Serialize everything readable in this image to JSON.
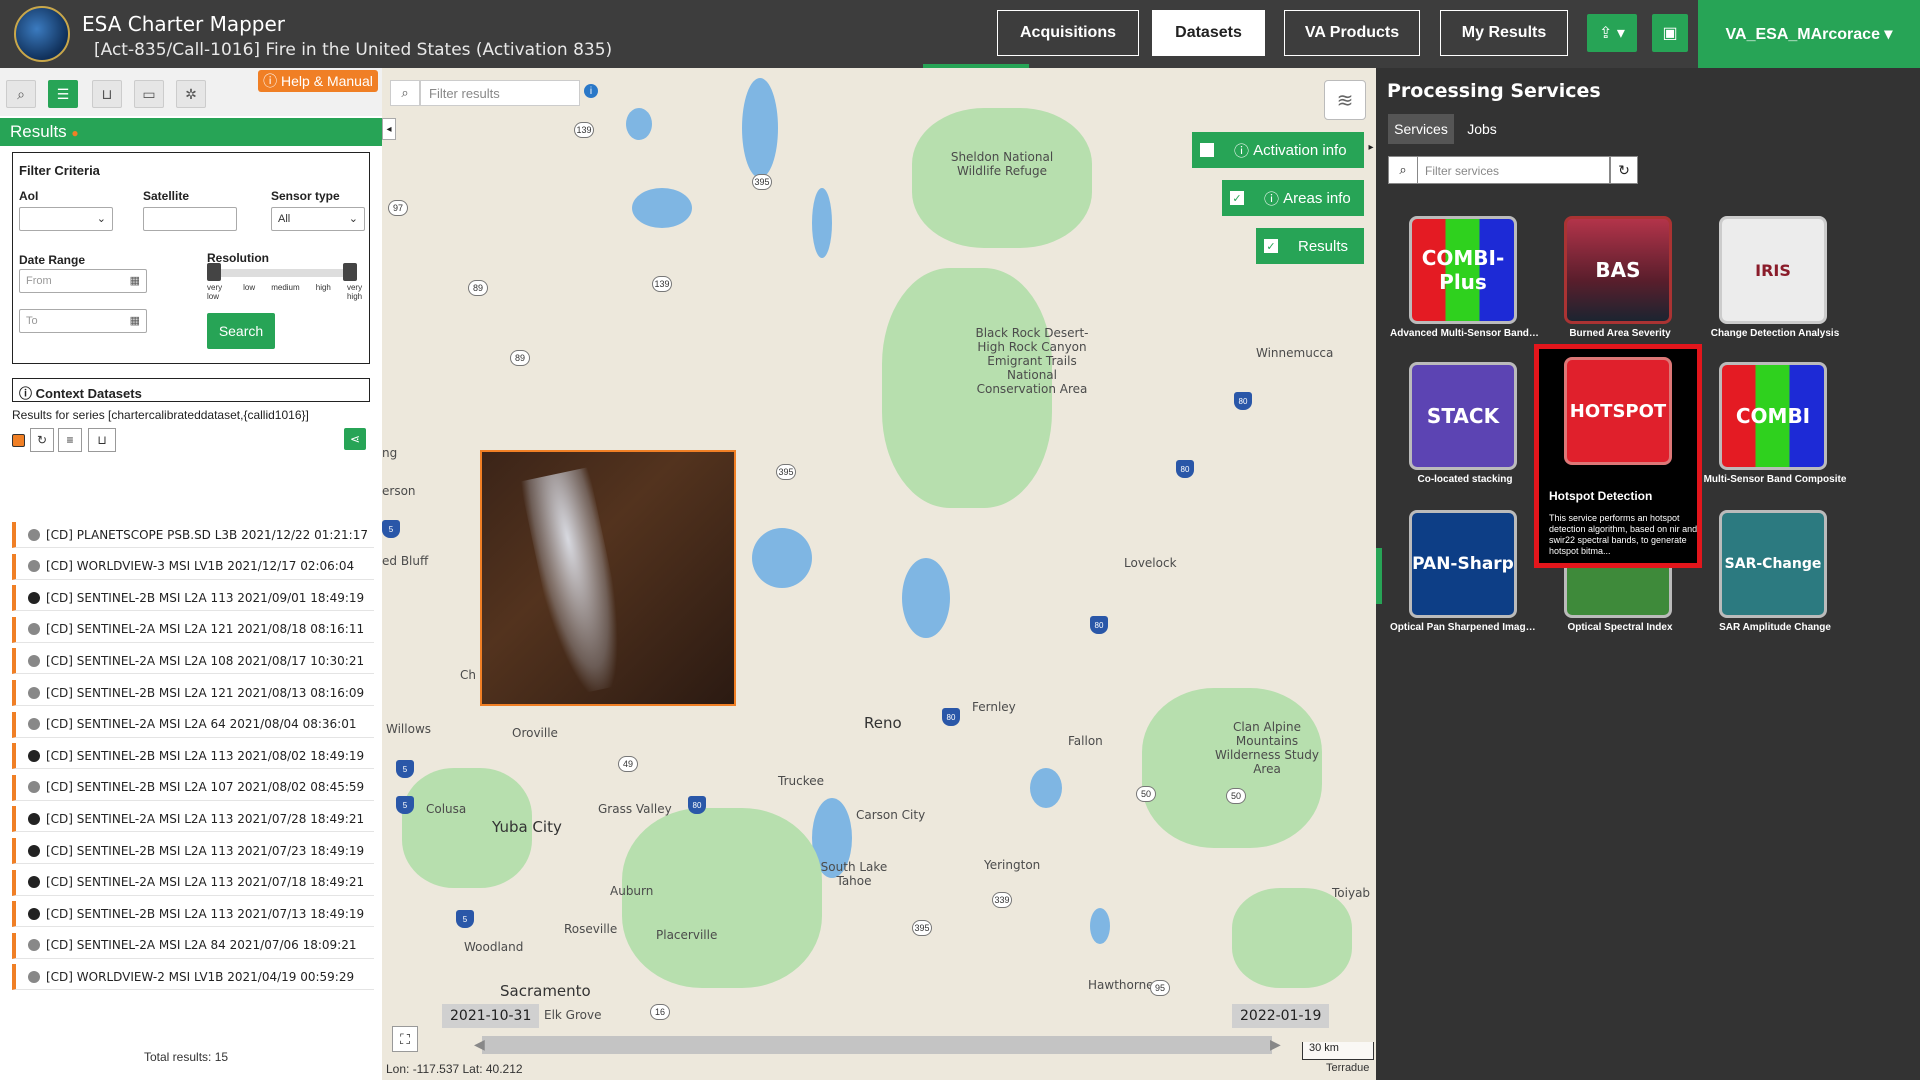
{
  "header": {
    "app_title": "ESA Charter Mapper",
    "activation_title": "[Act-835/Call-1016] Fire in the United States (Activation 835)",
    "nav": [
      {
        "label": "Acquisitions"
      },
      {
        "label": "Datasets"
      },
      {
        "label": "VA Products"
      },
      {
        "label": "My Results"
      }
    ],
    "upload_icon": "upload-icon",
    "briefcase_icon": "briefcase-icon",
    "user": "VA_ESA_MArcorace ▾"
  },
  "left": {
    "help": "Help & Manual",
    "results_title": "Results",
    "filter": {
      "title": "Filter Criteria",
      "aoi_label": "AoI",
      "satellite_label": "Satellite",
      "sensor_label": "Sensor type",
      "sensor_value": "All",
      "date_range_label": "Date Range",
      "from_placeholder": "From",
      "to_placeholder": "To",
      "resolution_label": "Resolution",
      "res_ticks": [
        "very low",
        "low",
        "medium",
        "high",
        "very high"
      ],
      "search_label": "Search"
    },
    "context_label": "Context Datasets",
    "series_label": "Results for series [chartercalibrateddataset,{callid1016}]",
    "items": [
      {
        "text": "[CD] PLANETSCOPE PSB.SD L3B 2021/12/22 01:21:17",
        "dark": false
      },
      {
        "text": "[CD] WORLDVIEW-3 MSI LV1B 2021/12/17 02:06:04",
        "dark": false
      },
      {
        "text": "[CD] SENTINEL-2B MSI L2A 113 2021/09/01 18:49:19",
        "dark": true
      },
      {
        "text": "[CD] SENTINEL-2A MSI L2A 121 2021/08/18 08:16:11",
        "dark": false
      },
      {
        "text": "[CD] SENTINEL-2A MSI L2A 108 2021/08/17 10:30:21",
        "dark": false
      },
      {
        "text": "[CD] SENTINEL-2B MSI L2A 121 2021/08/13 08:16:09",
        "dark": false
      },
      {
        "text": "[CD] SENTINEL-2A MSI L2A 64 2021/08/04 08:36:01",
        "dark": false
      },
      {
        "text": "[CD] SENTINEL-2B MSI L2A 113 2021/08/02 18:49:19",
        "dark": true
      },
      {
        "text": "[CD] SENTINEL-2B MSI L2A 107 2021/08/02 08:45:59",
        "dark": false
      },
      {
        "text": "[CD] SENTINEL-2A MSI L2A 113 2021/07/28 18:49:21",
        "dark": true
      },
      {
        "text": "[CD] SENTINEL-2B MSI L2A 113 2021/07/23 18:49:19",
        "dark": true
      },
      {
        "text": "[CD] SENTINEL-2A MSI L2A 113 2021/07/18 18:49:21",
        "dark": true
      },
      {
        "text": "[CD] SENTINEL-2B MSI L2A 113 2021/07/13 18:49:19",
        "dark": true
      },
      {
        "text": "[CD] SENTINEL-2A MSI L2A 84 2021/07/06 18:09:21",
        "dark": false
      },
      {
        "text": "[CD] WORLDVIEW-2 MSI LV1B 2021/04/19 00:59:29",
        "dark": false
      }
    ],
    "total": "Total results: 15"
  },
  "map": {
    "filter_placeholder": "Filter results",
    "activation_info": "Activation info",
    "areas_info": "Areas info",
    "results": "Results",
    "date_start": "2021-10-31",
    "date_end": "2022-01-19",
    "coords": "Lon: -117.537 Lat: 40.212",
    "scale": "30 km",
    "attribution": "Terradue",
    "labels": {
      "sheldon": "Sheldon National Wildlife Refuge",
      "blackrock": "Black Rock Desert-High Rock Canyon Emigrant Trails National Conservation Area",
      "winnemucca": "Winnemucca",
      "lovelock": "Lovelock",
      "fernley": "Fernley",
      "reno": "Reno",
      "fallon": "Fallon",
      "clan_alpine": "Clan Alpine Mountains Wilderness Study Area",
      "carson": "Carson City",
      "slt": "South Lake Tahoe",
      "yerington": "Yerington",
      "truckee": "Truckee",
      "grass_valley": "Grass Valley",
      "yuba": "Yuba City",
      "auburn": "Auburn",
      "roseville": "Roseville",
      "placerville": "Placerville",
      "woodland": "Woodland",
      "sacramento": "Sacramento",
      "elk_grove": "Elk Grove",
      "hawthorne": "Hawthorne",
      "oroville": "Oroville",
      "willows": "Willows",
      "colusa": "Colusa",
      "red_bluff": "ed Bluff",
      "erson": "erson",
      "ch": "Ch",
      "ng": "ng",
      "toiyab": "Toiyab"
    },
    "shields": [
      "139",
      "395",
      "97",
      "89",
      "139",
      "89",
      "395",
      "80",
      "80",
      "80",
      "80",
      "5",
      "5",
      "5",
      "49",
      "80",
      "50",
      "50",
      "339",
      "395",
      "95",
      "16",
      "5"
    ]
  },
  "right": {
    "title": "Processing Services",
    "tab_services": "Services",
    "tab_jobs": "Jobs",
    "filter_placeholder": "Filter services",
    "services": [
      {
        "icon_text": "COMBI-Plus",
        "label": "Advanced Multi-Sensor Band C..."
      },
      {
        "icon_text": "BAS",
        "label": "Burned Area Severity"
      },
      {
        "icon_text": "IRIS",
        "label": "Change Detection Analysis"
      },
      {
        "icon_text": "STACK",
        "label": "Co-located stacking"
      },
      {
        "icon_text": "HOTSPOT",
        "label": "Hotspot Detection"
      },
      {
        "icon_text": "COMBI",
        "label": "Multi-Sensor Band Composite"
      },
      {
        "icon_text": "PAN-Sharp",
        "label": "Optical Pan Sharpened Image ..."
      },
      {
        "icon_text": "",
        "label": "Optical Spectral Index"
      },
      {
        "icon_text": "SAR-Change",
        "label": "SAR Amplitude Change"
      }
    ],
    "hotspot_desc": "This service performs an hotspot detection algorithm, based on nir and swir22 spectral bands, to generate hotspot bitma..."
  }
}
